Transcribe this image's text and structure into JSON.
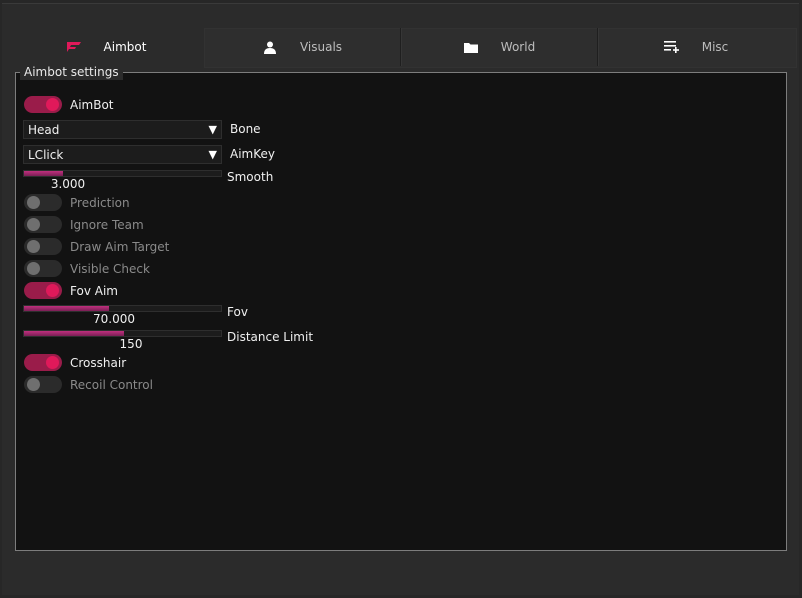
{
  "tabs": [
    {
      "label": "Aimbot",
      "icon": "aimbot-logo-icon",
      "active": true
    },
    {
      "label": "Visuals",
      "icon": "person-icon",
      "active": false
    },
    {
      "label": "World",
      "icon": "folder-icon",
      "active": false
    },
    {
      "label": "Misc",
      "icon": "list-add-icon",
      "active": false
    }
  ],
  "panel": {
    "title": "Aimbot settings"
  },
  "settings": {
    "aimbot": {
      "label": "AimBot",
      "on": true
    },
    "bone": {
      "value": "Head",
      "label": "Bone"
    },
    "aimkey": {
      "value": "LClick",
      "label": "AimKey"
    },
    "smooth": {
      "label": "Smooth",
      "value": "3.000",
      "fill": 0.2
    },
    "prediction": {
      "label": "Prediction",
      "on": false
    },
    "ignore_team": {
      "label": "Ignore Team",
      "on": false
    },
    "draw_aim_target": {
      "label": "Draw Aim Target",
      "on": false
    },
    "visible_check": {
      "label": "Visible Check",
      "on": false
    },
    "fov_aim": {
      "label": "Fov Aim",
      "on": true
    },
    "fov": {
      "label": "Fov",
      "value": "70.000",
      "fill": 0.43
    },
    "distance_limit": {
      "label": "Distance Limit",
      "value": "150",
      "fill": 0.51
    },
    "crosshair": {
      "label": "Crosshair",
      "on": true
    },
    "recoil_control": {
      "label": "Recoil Control",
      "on": false
    }
  },
  "colors": {
    "accent": "#e0195a",
    "accent_dark": "#9a1c4a",
    "panel_bg": "#121212"
  }
}
